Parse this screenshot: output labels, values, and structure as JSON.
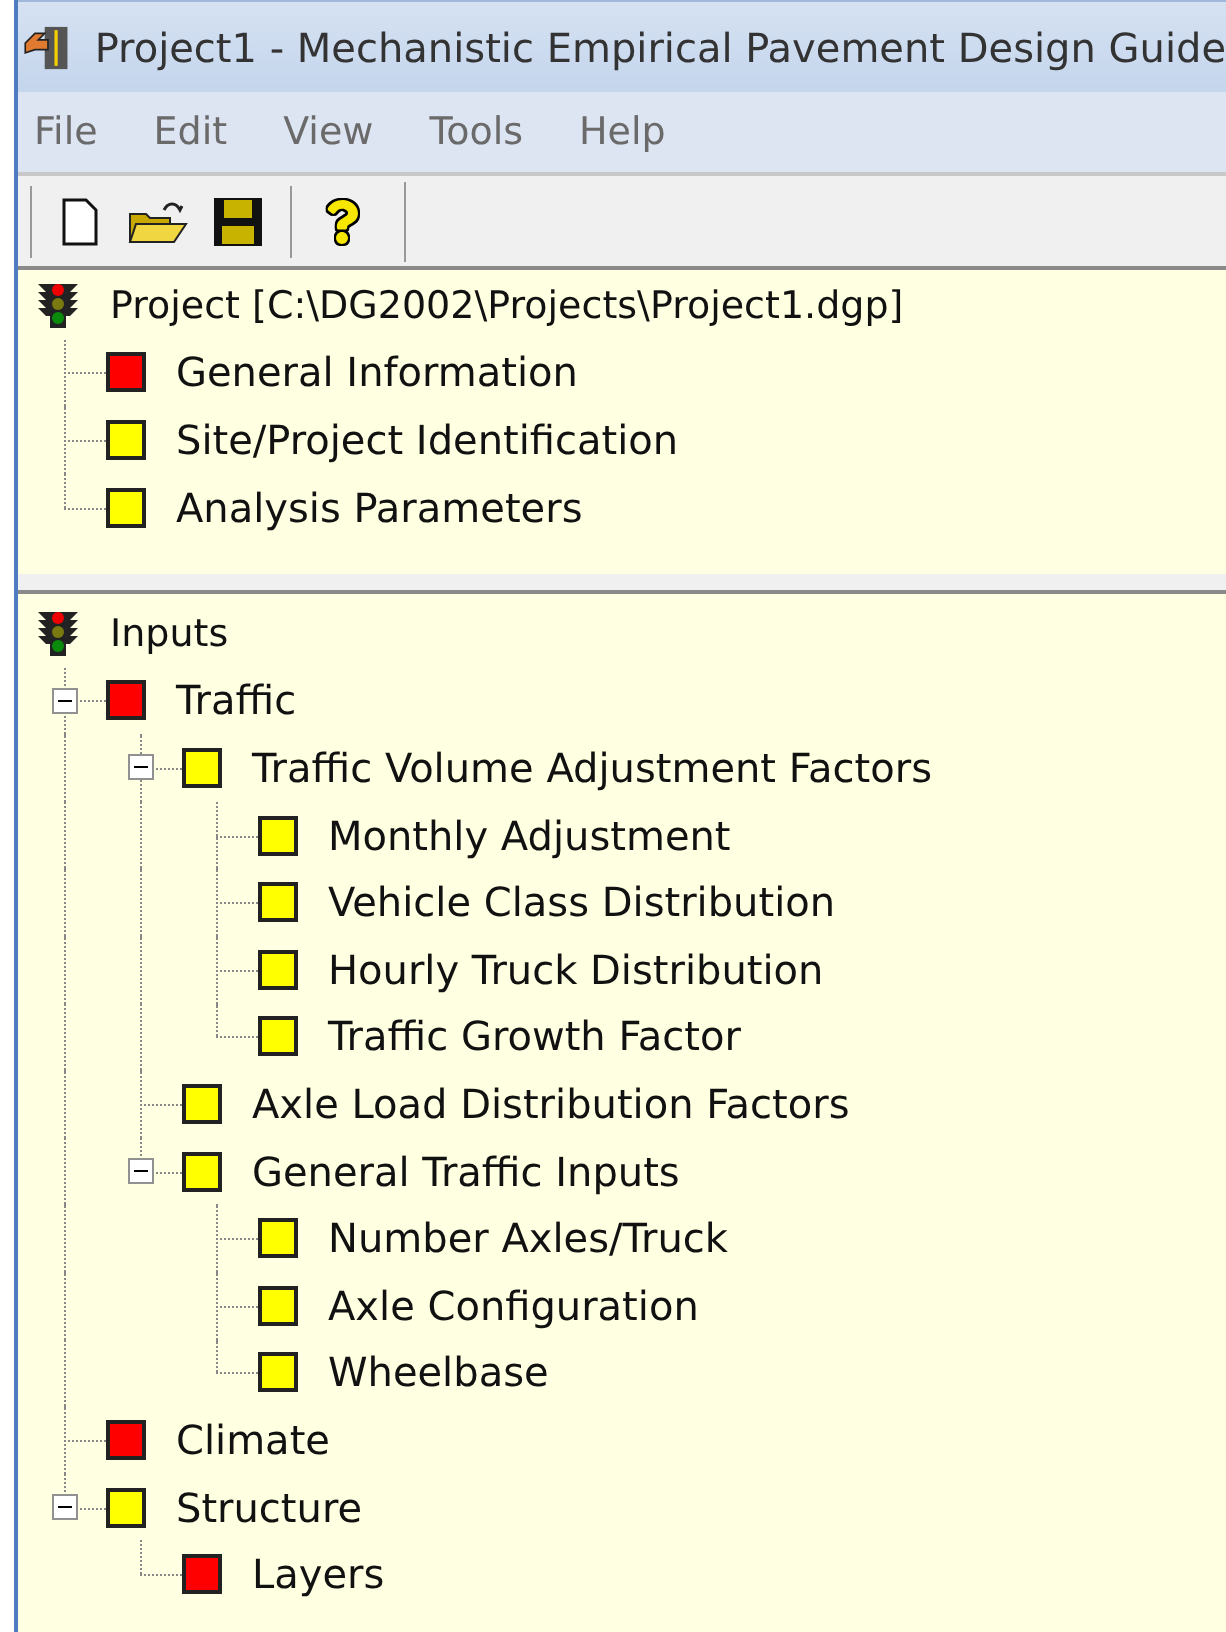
{
  "window": {
    "title": "Project1 - Mechanistic Empirical Pavement Design Guide"
  },
  "menu": [
    "File",
    "Edit",
    "View",
    "Tools",
    "Help"
  ],
  "project_tree": {
    "label": "Project [C:\\DG2002\\Projects\\Project1.dgp]",
    "children": [
      {
        "label": "General Information",
        "color": "#ff0000"
      },
      {
        "label": "Site/Project Identification",
        "color": "#ffff00"
      },
      {
        "label": "Analysis Parameters",
        "color": "#ffff00"
      }
    ]
  },
  "inputs_tree": {
    "label": "Inputs",
    "children": [
      {
        "label": "Traffic",
        "color": "#ff0000",
        "expanded": true,
        "children": [
          {
            "label": "Traffic Volume Adjustment Factors",
            "color": "#ffff00",
            "expanded": true,
            "children": [
              {
                "label": "Monthly Adjustment",
                "color": "#ffff00"
              },
              {
                "label": "Vehicle Class Distribution",
                "color": "#ffff00"
              },
              {
                "label": "Hourly Truck Distribution",
                "color": "#ffff00"
              },
              {
                "label": "Traffic Growth Factor",
                "color": "#ffff00"
              }
            ]
          },
          {
            "label": "Axle Load Distribution Factors",
            "color": "#ffff00"
          },
          {
            "label": "General Traffic Inputs",
            "color": "#ffff00",
            "expanded": true,
            "children": [
              {
                "label": "Number Axles/Truck",
                "color": "#ffff00"
              },
              {
                "label": "Axle Configuration",
                "color": "#ffff00"
              },
              {
                "label": "Wheelbase",
                "color": "#ffff00"
              }
            ]
          }
        ]
      },
      {
        "label": "Climate",
        "color": "#ff0000"
      },
      {
        "label": "Structure",
        "color": "#ffff00",
        "expanded": true,
        "children": [
          {
            "label": "Layers",
            "color": "#ff0000"
          }
        ]
      }
    ]
  }
}
